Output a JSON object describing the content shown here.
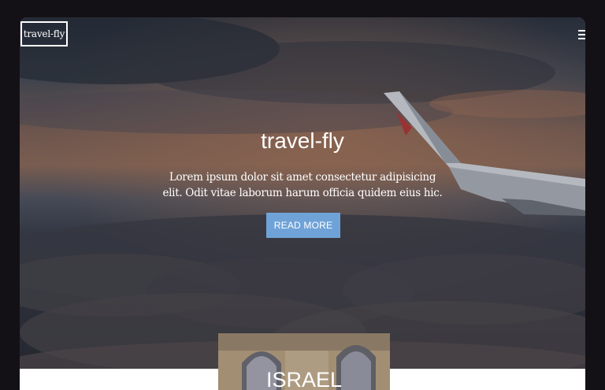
{
  "header": {
    "logo_text": "travel-fly",
    "menu_icon": "hamburger-icon"
  },
  "hero": {
    "title": "travel-fly",
    "description": "Lorem ipsum dolor sit amet consectetur adipisicing elit. Odit vitae laborum harum officia quidem eius hic.",
    "button_label": "READ MORE",
    "button_color": "#6fa3d8"
  },
  "destinations": [
    {
      "title": "ISRAEL"
    }
  ]
}
